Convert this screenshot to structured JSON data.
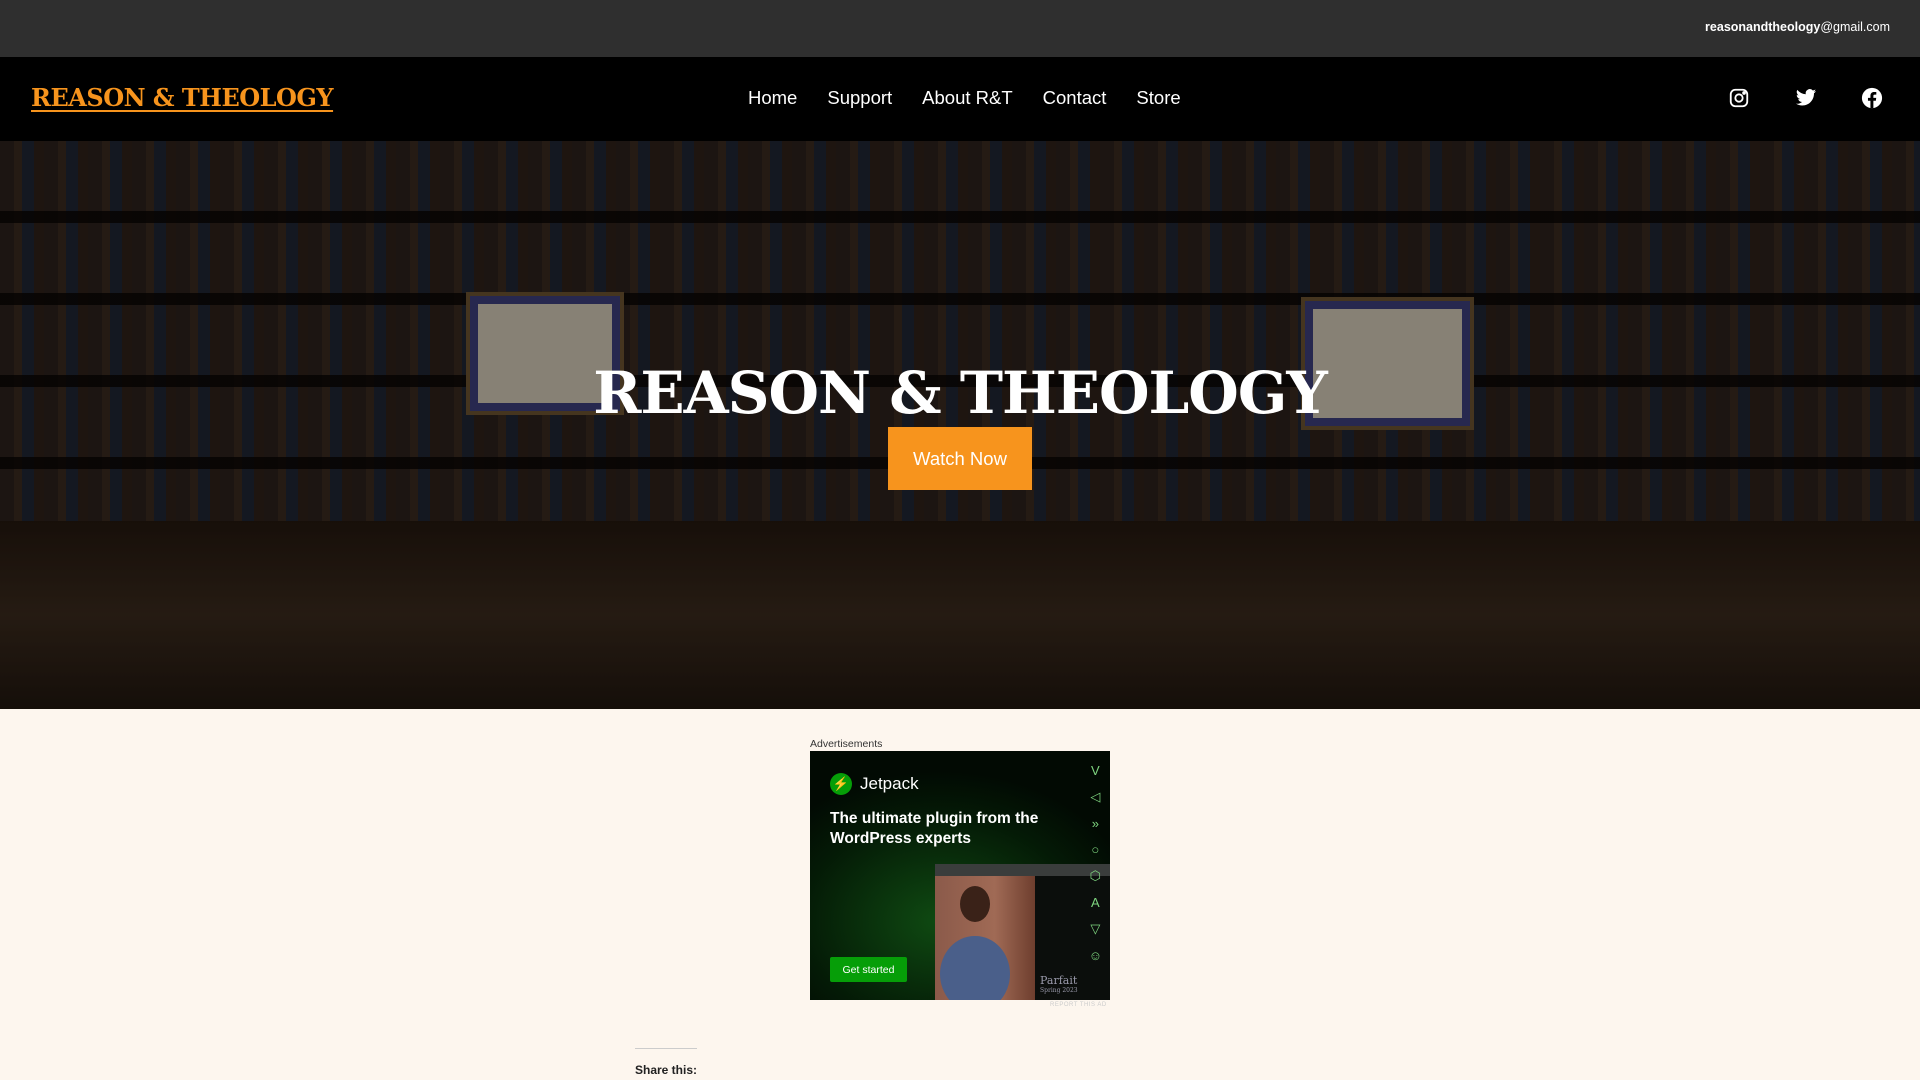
{
  "topbar": {
    "email_user": "reasonandtheology",
    "email_domain": "@gmail.com"
  },
  "nav": {
    "logo": "REASON & THEOLOGY",
    "items": [
      "Home",
      "Support",
      "About R&T",
      "Contact",
      "Store"
    ],
    "social": [
      "instagram-icon",
      "twitter-icon",
      "facebook-icon"
    ]
  },
  "hero": {
    "title": "REASON & THEOLOGY",
    "button": "Watch Now"
  },
  "ad": {
    "label": "Advertisements",
    "brand": "Jetpack",
    "headline": "The ultimate plugin from the WordPress experts",
    "cta": "Get started",
    "caption": "Parfait",
    "caption_sub": "Spring 2023",
    "report": "REPORT THIS AD"
  },
  "share": {
    "label": "Share this:"
  },
  "colors": {
    "accent": "#f7941d",
    "topbar": "#2f2f2f",
    "page_bg": "#fdf6ee",
    "jetpack_green": "#069e08"
  }
}
